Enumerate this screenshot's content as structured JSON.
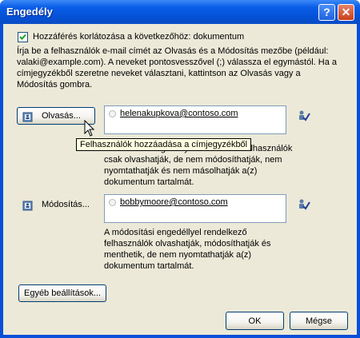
{
  "window": {
    "title": "Engedély",
    "help_glyph": "?",
    "close_glyph": "✕"
  },
  "restrict": {
    "checkbox_label": "Hozzáférés korlátozása a következőhöz: dokumentum",
    "checked": true
  },
  "intro_text": "Írja be a felhasználók e-mail címét az Olvasás és a Módosítás mezőbe (például: valaki@example.com). A neveket pontosvesszővel (;) válassza el egymástól. Ha a címjegyzékből szeretne neveket választani, kattintson az Olvasás vagy a Módosítás gombra.",
  "read": {
    "button_label": "Olvasás...",
    "user": "helenakupkova@contoso.com",
    "description": "Az olvasási engedéllyel rendelkező felhasználók csak olvashatják, de nem módosíthatják, nem nyomtathatják és nem másolhatják a(z) dokumentum tartalmát."
  },
  "tooltip": "Felhasználók hozzáadása a címjegyzékből",
  "change": {
    "button_label": "Módosítás...",
    "user": "bobbymoore@contoso.com",
    "description": "A módosítási engedéllyel rendelkező felhasználók olvashatják, módosíthatják és menthetik, de nem nyomtathatják a(z) dokumentum tartalmát."
  },
  "more_options_label": "Egyéb beállítások...",
  "ok_label": "OK",
  "cancel_label": "Mégse",
  "icons": {
    "address_book": "address-book-icon",
    "check_names": "check-names-icon",
    "cursor": "mouse-pointer-icon"
  }
}
